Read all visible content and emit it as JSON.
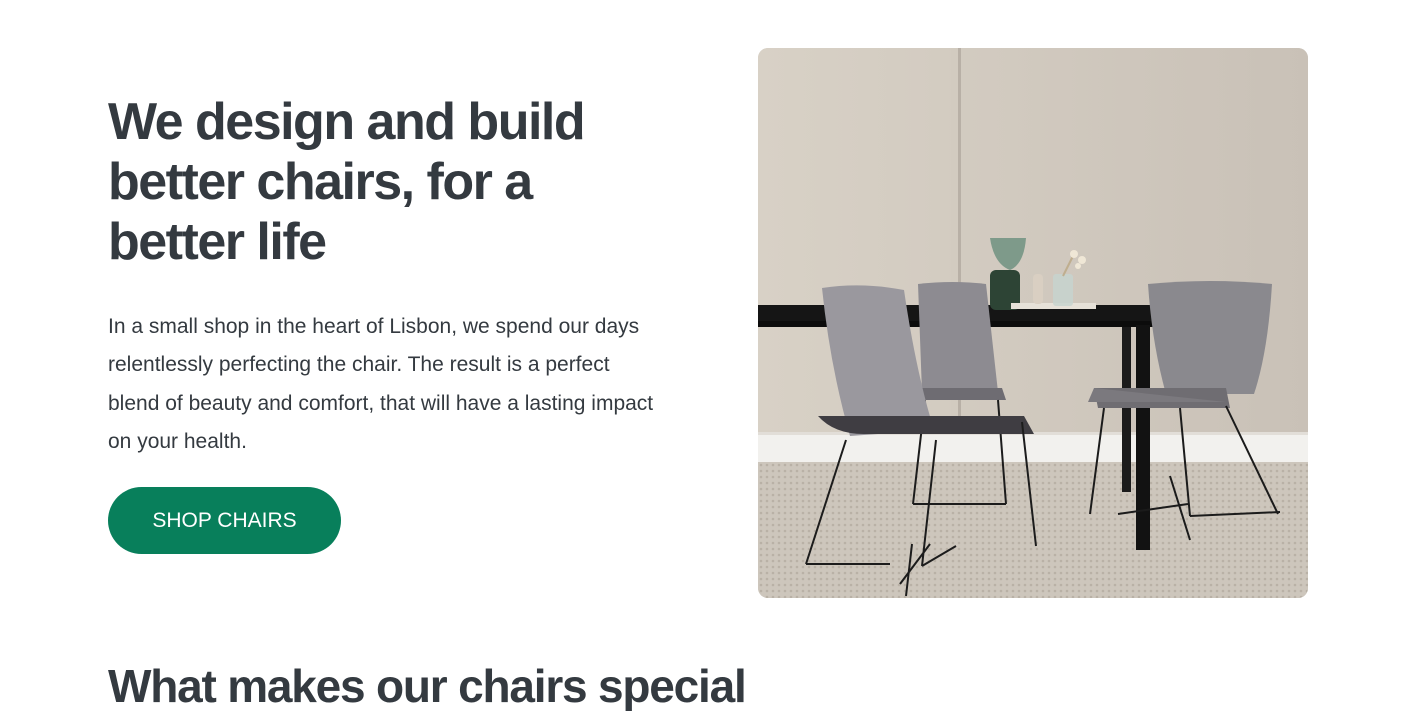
{
  "hero": {
    "title": "We design and build better chairs, for a better life",
    "description": "In a small shop in the heart of Lisbon, we spend our days relentlessly perfecting the chair. The result is a perfect blend of beauty and comfort, that will have a lasting impact on your health.",
    "cta_label": "SHOP CHAIRS",
    "image_alt": "Dining table with three grey upholstered chairs"
  },
  "features": {
    "title": "What makes our chairs special"
  },
  "colors": {
    "text": "#343a40",
    "accent": "#087f5b",
    "background": "#ffffff"
  }
}
